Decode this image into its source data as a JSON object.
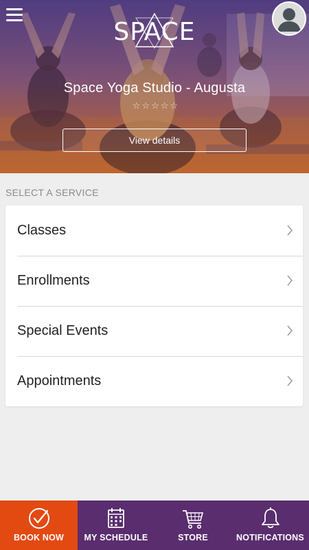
{
  "header": {
    "logo_text": "SPACE",
    "studio_name": "Space Yoga Studio - Augusta",
    "rating": {
      "value": 0,
      "max": 5,
      "star_glyph": "☆"
    },
    "view_details_label": "View details",
    "menu_icon": "hamburger-icon",
    "avatar_icon": "user-avatar-icon"
  },
  "services": {
    "section_label": "SELECT A SERVICE",
    "items": [
      {
        "label": "Classes",
        "icon": "chevron-right-icon"
      },
      {
        "label": "Enrollments",
        "icon": "chevron-right-icon"
      },
      {
        "label": "Special Events",
        "icon": "chevron-right-icon"
      },
      {
        "label": "Appointments",
        "icon": "chevron-right-icon"
      }
    ]
  },
  "bottom_nav": {
    "items": [
      {
        "label": "BOOK NOW",
        "icon": "check-circle-icon",
        "active": true
      },
      {
        "label": "MY SCHEDULE",
        "icon": "calendar-icon",
        "active": false
      },
      {
        "label": "STORE",
        "icon": "cart-icon",
        "active": false
      },
      {
        "label": "NOTIFICATIONS",
        "icon": "bell-icon",
        "active": false
      }
    ]
  },
  "colors": {
    "nav_background": "#5a2d6e",
    "nav_active": "#e24a12",
    "hero_top": "#5d4a8a",
    "hero_bottom": "#c06a30",
    "page_background": "#eeeeee"
  }
}
